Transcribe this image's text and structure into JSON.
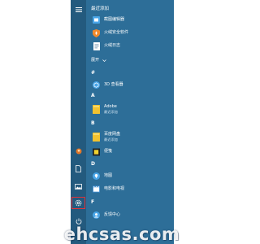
{
  "colors": {
    "panel": "#2d6e98",
    "rail": "#235a7e",
    "settings_highlight": "#e0343a",
    "icon_blue": "#4aa6e8",
    "icon_yellow": "#f2c22f"
  },
  "sections": {
    "recent": "最近添加",
    "hash": "#",
    "a": "A",
    "b": "B",
    "d": "D",
    "f": "F"
  },
  "expand_label": "展开",
  "apps": {
    "recent_1": "截图编辑器",
    "recent_2": "火绒安全软件",
    "recent_3": "火绒日志",
    "viewer3d": "3D 查看器",
    "adobe": "Adobe",
    "adobe_sub": "最近添加",
    "baidu": "百度网盘",
    "baidu_sub": "最近添加",
    "notes": "便笺",
    "maps": "地图",
    "movies": "电影和电视",
    "feedback": "反馈中心"
  },
  "watermark": "ehcsas.com"
}
